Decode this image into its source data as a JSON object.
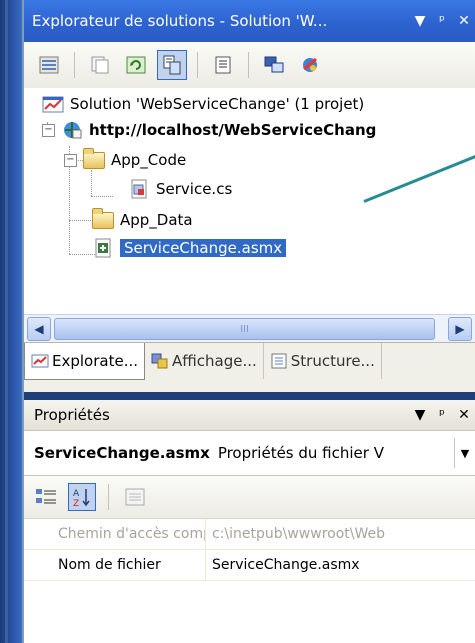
{
  "solution_explorer": {
    "title": "Explorateur de solutions - Solution 'W...",
    "title_buttons": [
      "▾",
      "ᵖ",
      "✕"
    ],
    "tree": {
      "solution": "Solution 'WebServiceChange' (1 projet)",
      "project": "http://localhost/WebServiceChang",
      "folder_app_code": "App_Code",
      "file_service": "Service.cs",
      "folder_app_data": "App_Data",
      "file_selected": "ServiceChange.asmx"
    },
    "scroll_thumb_grip": "III",
    "tabs": [
      {
        "label": "Explorate..."
      },
      {
        "label": "Affichage..."
      },
      {
        "label": "Structure..."
      }
    ]
  },
  "properties": {
    "title": "Propriétés",
    "object_name": "ServiceChange.asmx",
    "object_type": "Propriétés du fichier V",
    "rows": [
      {
        "name": "Chemin d'accès comp",
        "value": "c:\\inetpub\\wwwroot\\Web"
      },
      {
        "name": "Nom de fichier",
        "value": "ServiceChange.asmx"
      }
    ]
  },
  "colors": {
    "title_bar": "#2d63d0",
    "selection": "#316ac5",
    "arrow": "#2a8c93"
  }
}
